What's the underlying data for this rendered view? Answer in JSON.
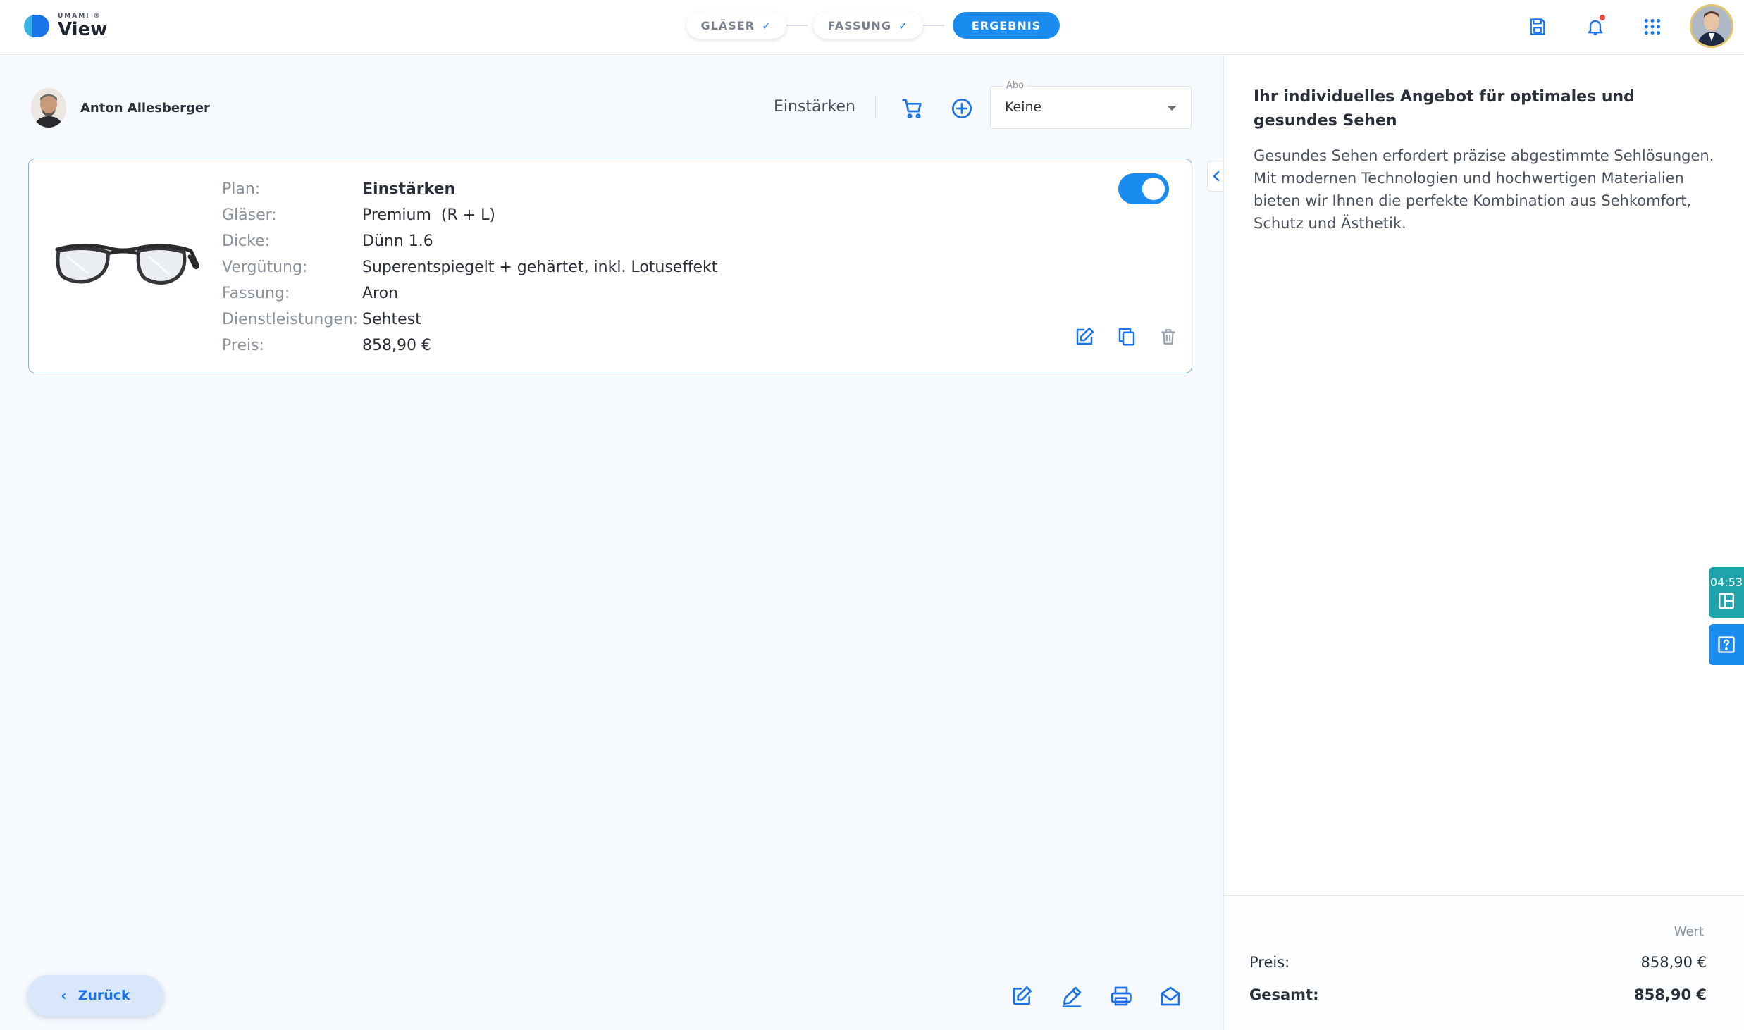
{
  "app": {
    "logo_small": "UMAMI ®",
    "logo_big": "View"
  },
  "stepper": {
    "steps": [
      {
        "label": "GLÄSER",
        "done": true
      },
      {
        "label": "FASSUNG",
        "done": true
      },
      {
        "label": "ERGEBNIS",
        "active": true
      }
    ]
  },
  "header_icons": [
    "save-icon",
    "bell-icon",
    "apps-grid-icon"
  ],
  "customer": {
    "name": "Anton Allesberger"
  },
  "toolbar": {
    "plan_label": "Einstärken",
    "abo_label": "Abo",
    "abo_value": "Keine"
  },
  "offer": {
    "rows": [
      {
        "key": "Plan:",
        "value": "Einstärken"
      },
      {
        "key": "Gläser:",
        "value": "Premium  (R + L)"
      },
      {
        "key": "Dicke:",
        "value": "Dünn 1.6"
      },
      {
        "key": "Vergütung:",
        "value": "Superentspiegelt + gehärtet, inkl. Lotuseffekt"
      },
      {
        "key": "Fassung:",
        "value": "Aron"
      },
      {
        "key": "Dienstleistungen:",
        "value": "Sehtest"
      },
      {
        "key": "Preis:",
        "value": "858,90 €"
      }
    ],
    "enabled": true
  },
  "footer": {
    "back_label": "Zurück"
  },
  "panel": {
    "title": "Ihr individuelles Angebot für optimales und gesundes Sehen",
    "text": "Gesundes Sehen erfordert präzise abgestimmte Sehlösungen. Mit modernen Technologien und hochwertigen Materialien bieten wir Ihnen die perfekte Kombination aus Sehkomfort, Schutz und Ästhetik.",
    "summary": {
      "col_head": "Wert",
      "price_label": "Preis:",
      "price_value": "858,90 €",
      "total_label": "Gesamt:",
      "total_value": "858,90 €"
    }
  },
  "side": {
    "timer": "04:53"
  },
  "colors": {
    "accent": "#1a8cf0",
    "border_card": "#7fb1e0",
    "timer_tab": "#1fa3ad"
  }
}
